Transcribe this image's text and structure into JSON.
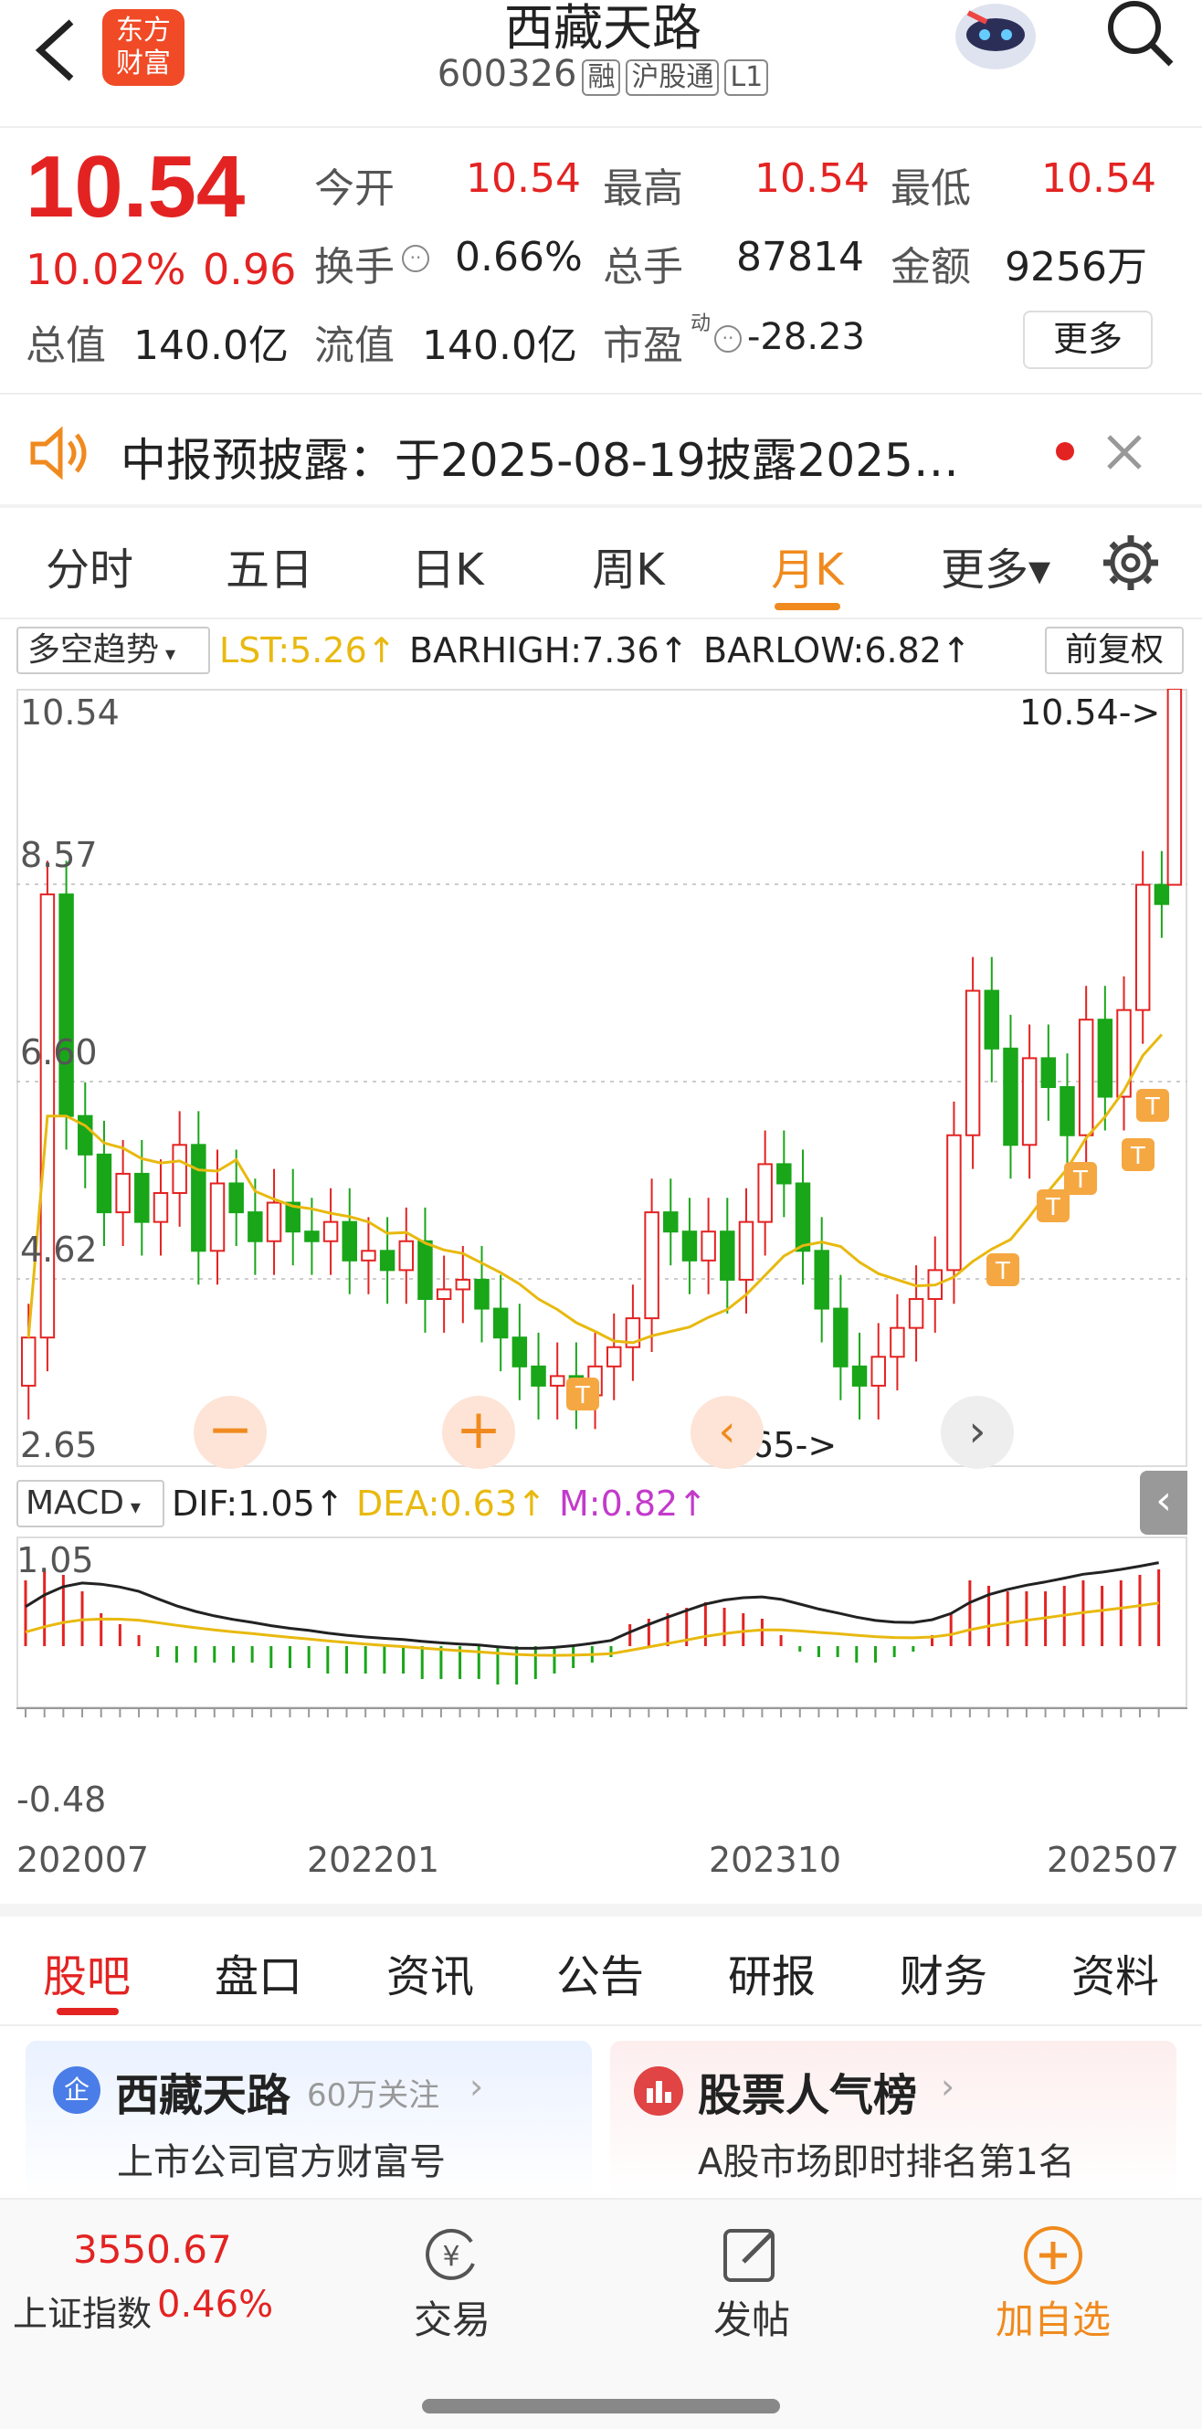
{
  "header": {
    "stock_name": "西藏天路",
    "code": "600326",
    "tags": [
      "融",
      "沪股通",
      "L1"
    ],
    "logo_line1": "东方",
    "logo_line2": "财富"
  },
  "quote": {
    "price": "10.54",
    "pct": "10.02%",
    "chg": "0.96",
    "r1": [
      [
        "今开",
        "10.54"
      ],
      [
        "最高",
        "10.54"
      ],
      [
        "最低",
        "10.54"
      ]
    ],
    "r2": [
      [
        "换手",
        "0.66%"
      ],
      [
        "总手",
        "87814"
      ],
      [
        "金额",
        "9256万"
      ]
    ],
    "total_label": "总值",
    "total_val": "140.0亿",
    "float_label": "流值",
    "float_val": "140.0亿",
    "pe_label": "市盈",
    "pe_sup": "动",
    "pe_val": "-28.23",
    "more": "更多"
  },
  "notice": {
    "text": "中报预披露：于2025-08-19披露2025…"
  },
  "tabs": [
    "分时",
    "五日",
    "日K",
    "周K",
    "月K",
    "更多▾"
  ],
  "active_tab": "月K",
  "kline": {
    "indicator": "多空趋势",
    "lst": "LST:5.26↑",
    "barhigh": "BARHIGH:7.36↑",
    "barlow": "BARLOW:6.82↑",
    "fq": "前复权",
    "y_labels": [
      "10.54",
      "8.57",
      "6.60",
      "4.62",
      "2.65"
    ],
    "max_note": "10.54->",
    "min_note": "2.65->"
  },
  "macd": {
    "name": "MACD",
    "dif": "DIF:1.05↑",
    "dea": "DEA:0.63↑",
    "m": "M:0.82↑",
    "ymax": "1.05",
    "ymin": "-0.48",
    "x_labels": [
      "202007",
      "202201",
      "202310",
      "202507"
    ]
  },
  "bottom_tabs": [
    "股吧",
    "盘口",
    "资讯",
    "公告",
    "研报",
    "财务",
    "资料"
  ],
  "cards": {
    "left_title": "西藏天路",
    "left_badge": "企",
    "left_follow": "60万关注",
    "left_sub": "上市公司官方财富号",
    "right_title": "股票人气榜",
    "right_sub": "A股市场即时排名第1名"
  },
  "nav": {
    "index_val": "3550.67",
    "index_name": "上证指数",
    "index_pct": "0.46%",
    "trade": "交易",
    "post": "发帖",
    "add": "加自选"
  },
  "colors": {
    "up": "#e32322",
    "down": "#19a619",
    "accent": "#f08a1e",
    "ma": "#e8b90f"
  }
}
